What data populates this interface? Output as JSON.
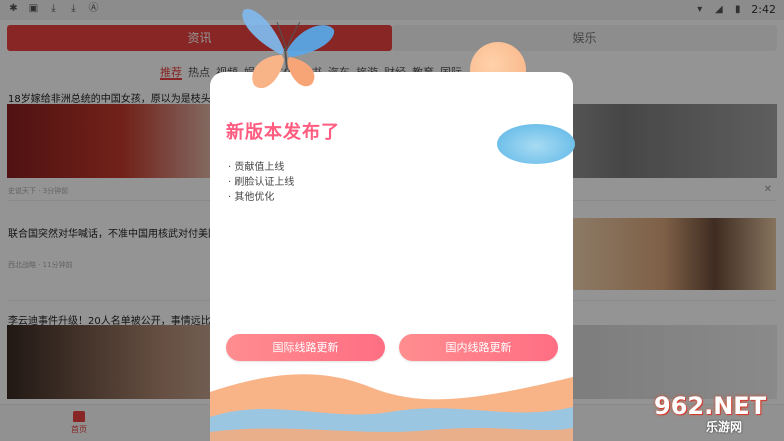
{
  "status_bar": {
    "time": "2:42",
    "left_icons": [
      "app-icon",
      "notification-icon",
      "download-icon",
      "download-icon",
      "text-icon"
    ],
    "right_icons": [
      "wifi-icon",
      "signal-icon",
      "battery-icon"
    ]
  },
  "top_tabs": [
    {
      "label": "资讯",
      "active": true
    },
    {
      "label": "娱乐",
      "active": false
    }
  ],
  "categories": [
    "推荐",
    "热点",
    "视频",
    "娱乐",
    "文化",
    "读书",
    "汽车",
    "旅游",
    "财经",
    "教育",
    "国际"
  ],
  "news": [
    {
      "title": "18岁嫁给非洲总统的中国女孩，原以为是枝头凤凰",
      "meta": "史说天下 · 3分钟前"
    },
    {
      "title": "联合国突然对华喊话，不准中国用核武对付美国",
      "meta": "西北战略 · 11分钟前"
    },
    {
      "title": "李云迪事件升级！20人名单被公开，事情远比想象",
      "meta": ""
    }
  ],
  "bottom_nav": {
    "home_label": "首页"
  },
  "dialog": {
    "title": "新版本发布了",
    "notes": [
      "· 贡献值上线",
      "· 刷脸认证上线",
      "· 其他优化"
    ],
    "button_intl": "国际线路更新",
    "button_domestic": "国内线路更新"
  },
  "watermark": {
    "logo_text": "962.NET",
    "sub_text": "乐游网"
  },
  "colors": {
    "accent": "#e8423f",
    "dialog_title": "#ff5c7f",
    "button": "#ff7a88",
    "cloud": "#57b4e6",
    "sun": "#f7b282"
  }
}
